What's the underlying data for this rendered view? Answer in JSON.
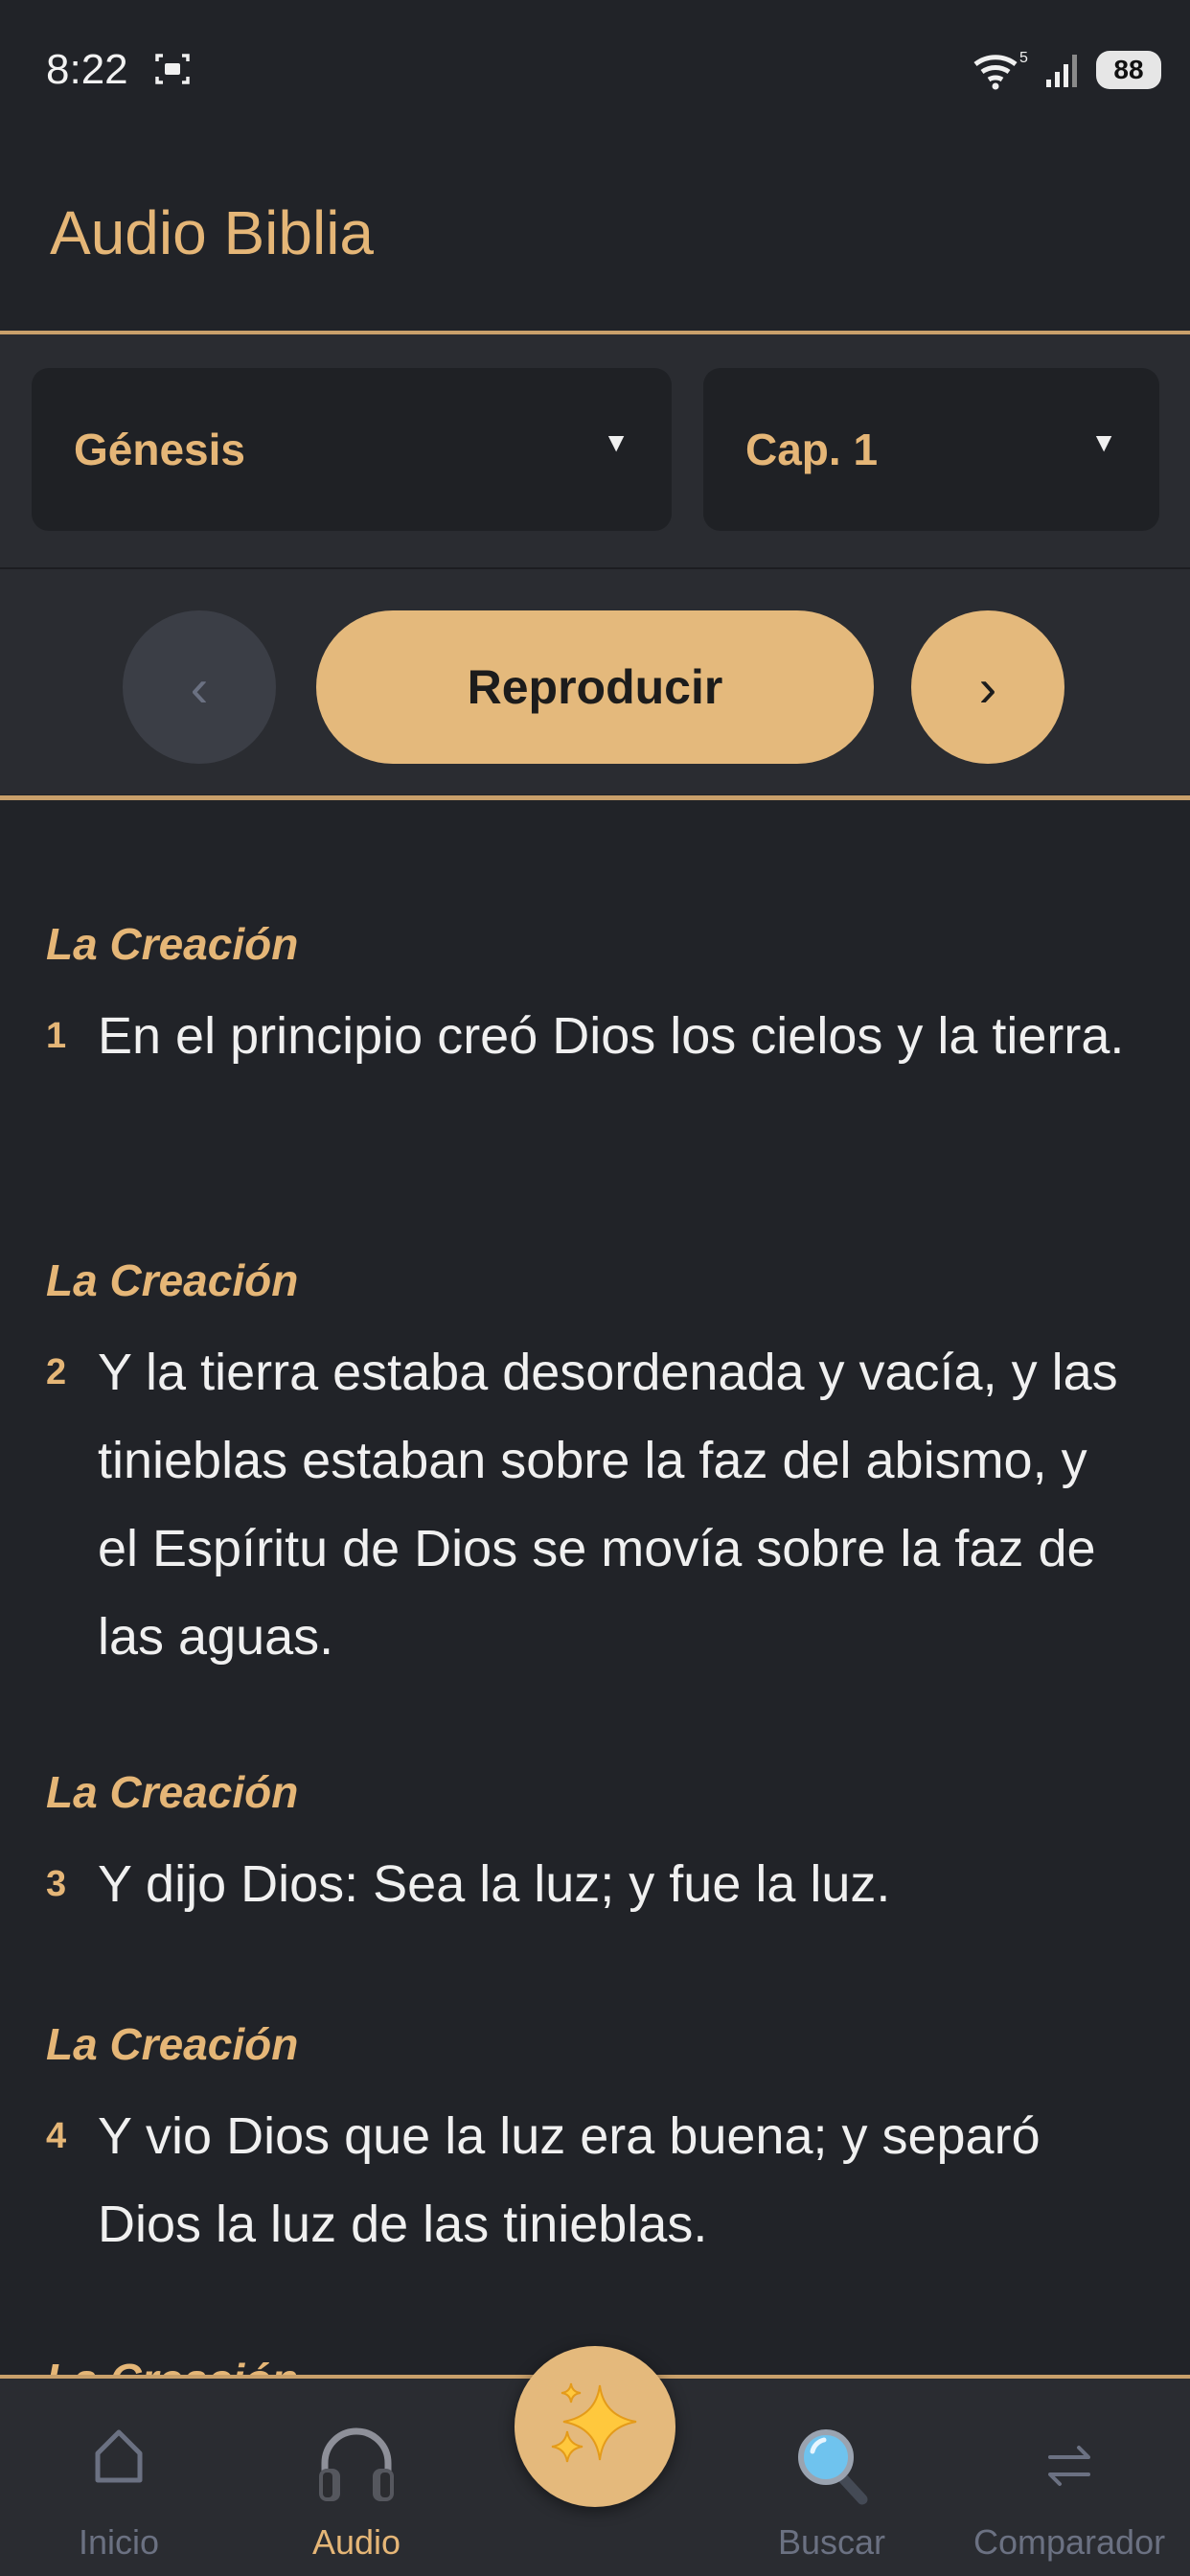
{
  "status": {
    "time": "8:22",
    "battery": "88",
    "wifi_badge": "5"
  },
  "app": {
    "title": "Audio Biblia"
  },
  "controls": {
    "book": "Génesis",
    "chapter": "Cap. 1",
    "dropdown_icon": "triangle-down",
    "prev_label": "‹",
    "play_label": "Reproducir",
    "next_label": "›"
  },
  "verses": [
    {
      "heading": "La Creación",
      "number": "1",
      "text": "En el principio creó Dios los cielos y la tierra."
    },
    {
      "heading": "La Creación",
      "number": "2",
      "text": "Y la tierra estaba desordenada y vacía, y las tinieblas estaban sobre la faz del abismo, y el Espíritu de Dios se movía sobre la faz de las aguas."
    },
    {
      "heading": "La Creación",
      "number": "3",
      "text": "Y dijo Dios: Sea la luz;  y fue la luz."
    },
    {
      "heading": "La Creación",
      "number": "4",
      "text": "Y vio Dios que la luz era buena; y separó Dios la luz de las tinieblas."
    },
    {
      "heading": "La Creación"
    }
  ],
  "nav": {
    "items": [
      {
        "label": "Inicio",
        "icon": "home-icon",
        "active": false
      },
      {
        "label": "Audio",
        "icon": "headphones-icon",
        "active": true
      },
      {
        "label": "Buscar",
        "icon": "magnifier-icon",
        "active": false
      },
      {
        "label": "Comparador",
        "icon": "swap-arrows-icon",
        "active": false
      }
    ],
    "center_icon": "sparkles-icon"
  },
  "colors": {
    "accent": "#e5b677",
    "background": "#212328",
    "panel": "#2a2c31",
    "inactive": "#6b7182"
  }
}
